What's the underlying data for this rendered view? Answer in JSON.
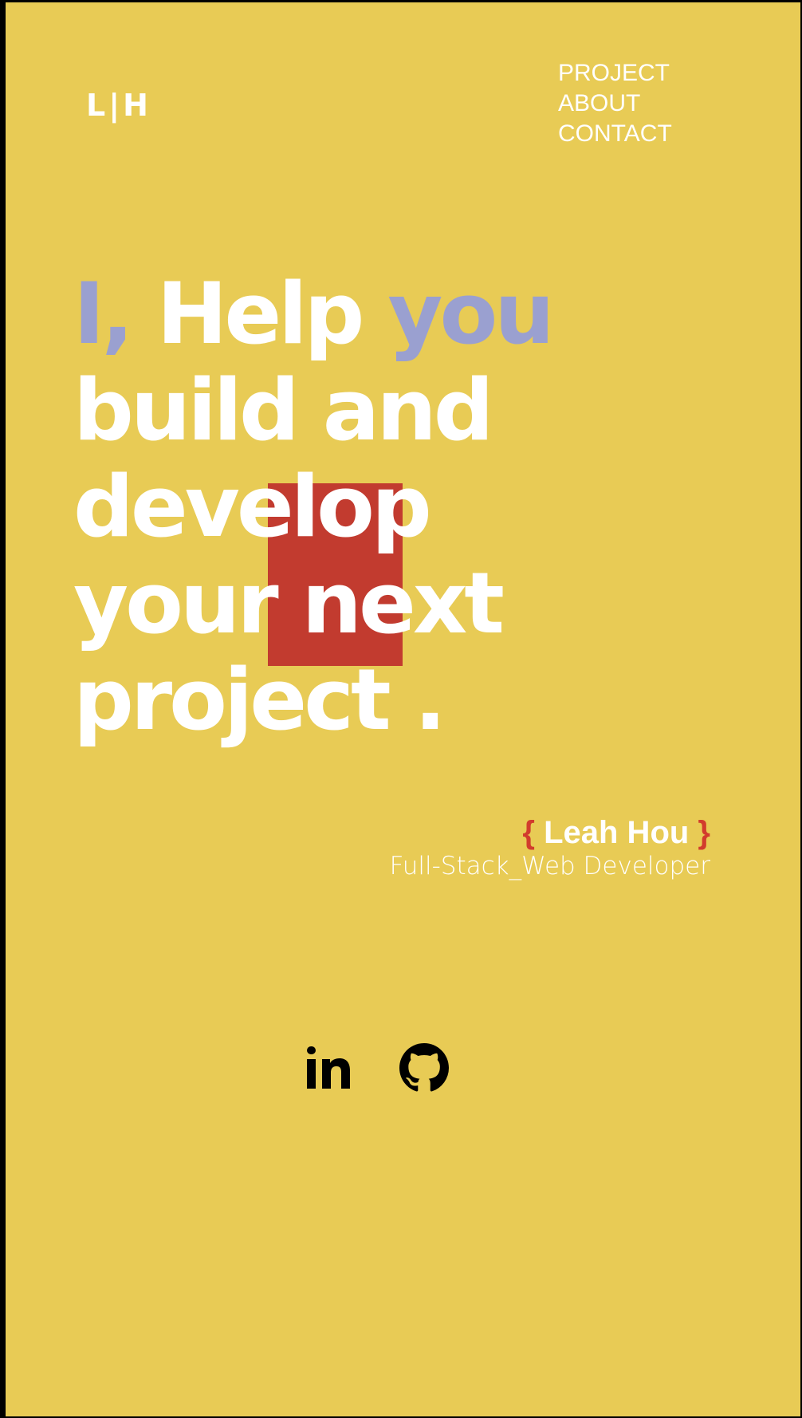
{
  "logo": {
    "text": "L|H"
  },
  "nav": {
    "items": [
      {
        "label": "PROJECT"
      },
      {
        "label": "ABOUT"
      },
      {
        "label": "CONTACT"
      }
    ]
  },
  "hero": {
    "line1": {
      "accent1": "I,",
      "middle": " Help ",
      "accent2": "you"
    },
    "line2": "build and",
    "line3": "develop",
    "line4": "your next",
    "line5": "project ."
  },
  "signature": {
    "open_brace": "{",
    "name": " Leah Hou ",
    "close_brace": "}",
    "role": "Full-Stack_Web Developer"
  },
  "social": {
    "linkedin_icon": "linkedin-icon",
    "github_icon": "github-icon"
  },
  "colors": {
    "background": "#e8cb55",
    "accent_blue": "#9aa0d0",
    "highlight_red": "#c23b2f",
    "brace_red": "#d23c2d",
    "text": "#ffffff"
  }
}
